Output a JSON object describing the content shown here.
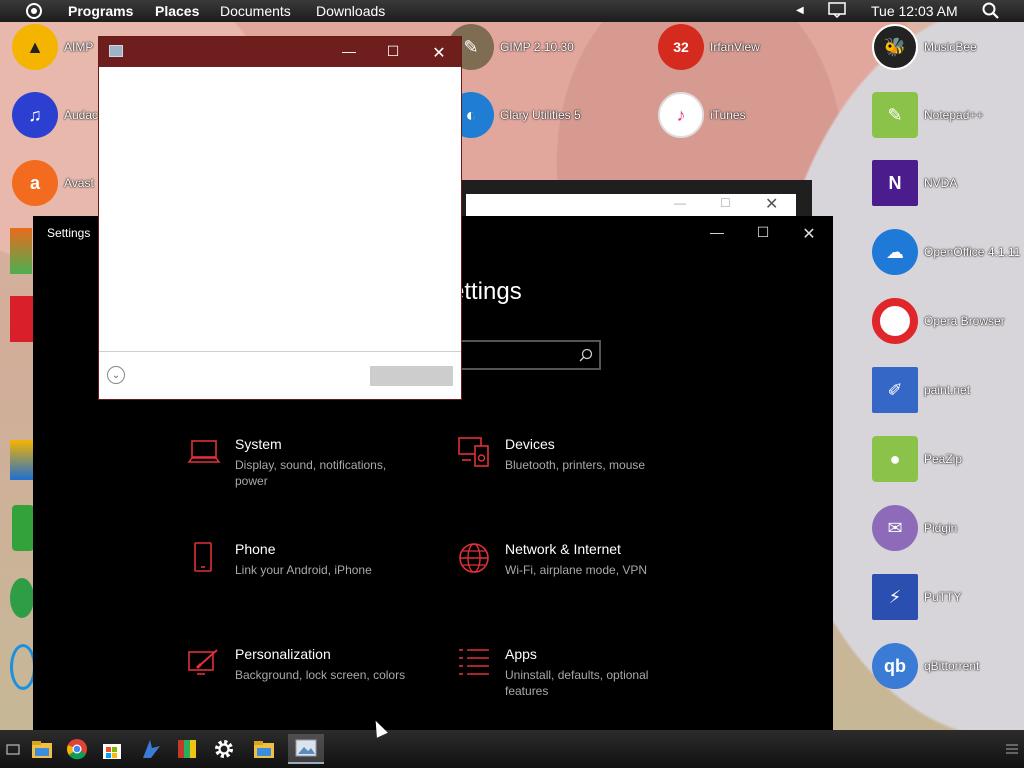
{
  "panel": {
    "menus": [
      "Programs",
      "Places",
      "Documents",
      "Downloads"
    ],
    "clock": "Tue 12:03 AM"
  },
  "desktop": {
    "left_icons": [
      "AIMP",
      "Audac",
      "Avast"
    ],
    "mid_icons": [
      "GIMP 2.10.30",
      "Glary Utilities 5"
    ],
    "irfan_icons": [
      "IrfanView",
      "iTunes"
    ],
    "irfan_badge": "32",
    "right_icons": [
      "MusicBee",
      "Notepad++",
      "NVDA",
      "OpenOffice 4.1.11",
      "Opera Browser",
      "paint.net",
      "PeaZip",
      "Pidgin",
      "PuTTY",
      "qBittorrent"
    ]
  },
  "settings": {
    "window_title": "Settings",
    "heading": "ettings",
    "search_placeholder": "",
    "categories": [
      {
        "title": "System",
        "sub": "Display, sound, notifications, power",
        "icon": "laptop-icon"
      },
      {
        "title": "Devices",
        "sub": "Bluetooth, printers, mouse",
        "icon": "devices-icon"
      },
      {
        "title": "Phone",
        "sub": "Link your Android, iPhone",
        "icon": "phone-icon"
      },
      {
        "title": "Network & Internet",
        "sub": "Wi-Fi, airplane mode, VPN",
        "icon": "globe-icon"
      },
      {
        "title": "Personalization",
        "sub": "Background, lock screen, colors",
        "icon": "paintbrush-icon"
      },
      {
        "title": "Apps",
        "sub": "Uninstall, defaults, optional features",
        "icon": "apps-list-icon"
      }
    ],
    "accent": "#e0303a"
  },
  "colors": {
    "dialog_titlebar": "#6e1f1d",
    "taskbar": "#1c1c1c"
  },
  "taskbar": {
    "items": [
      "file-manager-icon",
      "chrome-icon",
      "store-icon",
      "bird-app-icon",
      "archive-icon",
      "settings-gear-icon",
      "folder-icon",
      "image-viewer-icon"
    ]
  }
}
